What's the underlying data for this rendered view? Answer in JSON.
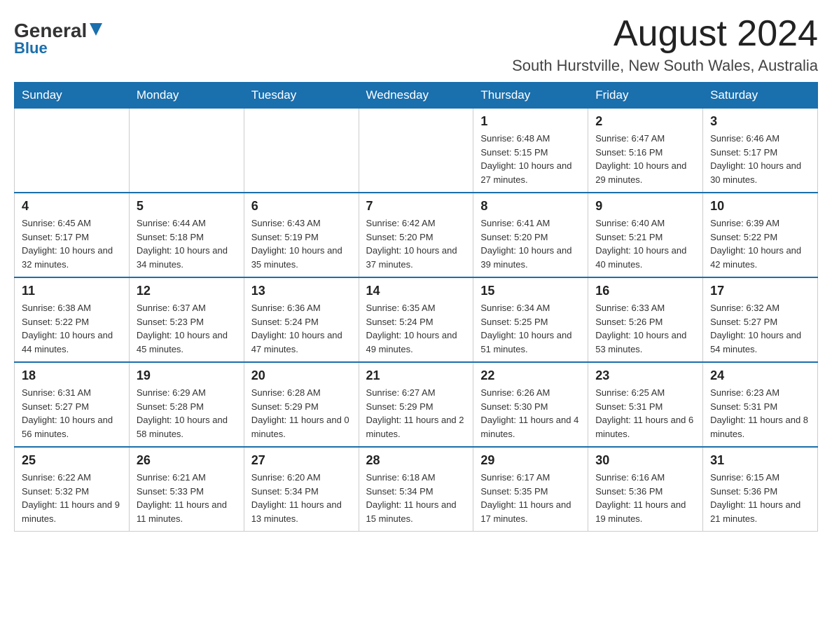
{
  "header": {
    "logo_general": "General",
    "logo_blue": "Blue",
    "month_title": "August 2024",
    "location": "South Hurstville, New South Wales, Australia"
  },
  "days_of_week": [
    "Sunday",
    "Monday",
    "Tuesday",
    "Wednesday",
    "Thursday",
    "Friday",
    "Saturday"
  ],
  "weeks": [
    [
      {
        "day": "",
        "info": ""
      },
      {
        "day": "",
        "info": ""
      },
      {
        "day": "",
        "info": ""
      },
      {
        "day": "",
        "info": ""
      },
      {
        "day": "1",
        "info": "Sunrise: 6:48 AM\nSunset: 5:15 PM\nDaylight: 10 hours and 27 minutes."
      },
      {
        "day": "2",
        "info": "Sunrise: 6:47 AM\nSunset: 5:16 PM\nDaylight: 10 hours and 29 minutes."
      },
      {
        "day": "3",
        "info": "Sunrise: 6:46 AM\nSunset: 5:17 PM\nDaylight: 10 hours and 30 minutes."
      }
    ],
    [
      {
        "day": "4",
        "info": "Sunrise: 6:45 AM\nSunset: 5:17 PM\nDaylight: 10 hours and 32 minutes."
      },
      {
        "day": "5",
        "info": "Sunrise: 6:44 AM\nSunset: 5:18 PM\nDaylight: 10 hours and 34 minutes."
      },
      {
        "day": "6",
        "info": "Sunrise: 6:43 AM\nSunset: 5:19 PM\nDaylight: 10 hours and 35 minutes."
      },
      {
        "day": "7",
        "info": "Sunrise: 6:42 AM\nSunset: 5:20 PM\nDaylight: 10 hours and 37 minutes."
      },
      {
        "day": "8",
        "info": "Sunrise: 6:41 AM\nSunset: 5:20 PM\nDaylight: 10 hours and 39 minutes."
      },
      {
        "day": "9",
        "info": "Sunrise: 6:40 AM\nSunset: 5:21 PM\nDaylight: 10 hours and 40 minutes."
      },
      {
        "day": "10",
        "info": "Sunrise: 6:39 AM\nSunset: 5:22 PM\nDaylight: 10 hours and 42 minutes."
      }
    ],
    [
      {
        "day": "11",
        "info": "Sunrise: 6:38 AM\nSunset: 5:22 PM\nDaylight: 10 hours and 44 minutes."
      },
      {
        "day": "12",
        "info": "Sunrise: 6:37 AM\nSunset: 5:23 PM\nDaylight: 10 hours and 45 minutes."
      },
      {
        "day": "13",
        "info": "Sunrise: 6:36 AM\nSunset: 5:24 PM\nDaylight: 10 hours and 47 minutes."
      },
      {
        "day": "14",
        "info": "Sunrise: 6:35 AM\nSunset: 5:24 PM\nDaylight: 10 hours and 49 minutes."
      },
      {
        "day": "15",
        "info": "Sunrise: 6:34 AM\nSunset: 5:25 PM\nDaylight: 10 hours and 51 minutes."
      },
      {
        "day": "16",
        "info": "Sunrise: 6:33 AM\nSunset: 5:26 PM\nDaylight: 10 hours and 53 minutes."
      },
      {
        "day": "17",
        "info": "Sunrise: 6:32 AM\nSunset: 5:27 PM\nDaylight: 10 hours and 54 minutes."
      }
    ],
    [
      {
        "day": "18",
        "info": "Sunrise: 6:31 AM\nSunset: 5:27 PM\nDaylight: 10 hours and 56 minutes."
      },
      {
        "day": "19",
        "info": "Sunrise: 6:29 AM\nSunset: 5:28 PM\nDaylight: 10 hours and 58 minutes."
      },
      {
        "day": "20",
        "info": "Sunrise: 6:28 AM\nSunset: 5:29 PM\nDaylight: 11 hours and 0 minutes."
      },
      {
        "day": "21",
        "info": "Sunrise: 6:27 AM\nSunset: 5:29 PM\nDaylight: 11 hours and 2 minutes."
      },
      {
        "day": "22",
        "info": "Sunrise: 6:26 AM\nSunset: 5:30 PM\nDaylight: 11 hours and 4 minutes."
      },
      {
        "day": "23",
        "info": "Sunrise: 6:25 AM\nSunset: 5:31 PM\nDaylight: 11 hours and 6 minutes."
      },
      {
        "day": "24",
        "info": "Sunrise: 6:23 AM\nSunset: 5:31 PM\nDaylight: 11 hours and 8 minutes."
      }
    ],
    [
      {
        "day": "25",
        "info": "Sunrise: 6:22 AM\nSunset: 5:32 PM\nDaylight: 11 hours and 9 minutes."
      },
      {
        "day": "26",
        "info": "Sunrise: 6:21 AM\nSunset: 5:33 PM\nDaylight: 11 hours and 11 minutes."
      },
      {
        "day": "27",
        "info": "Sunrise: 6:20 AM\nSunset: 5:34 PM\nDaylight: 11 hours and 13 minutes."
      },
      {
        "day": "28",
        "info": "Sunrise: 6:18 AM\nSunset: 5:34 PM\nDaylight: 11 hours and 15 minutes."
      },
      {
        "day": "29",
        "info": "Sunrise: 6:17 AM\nSunset: 5:35 PM\nDaylight: 11 hours and 17 minutes."
      },
      {
        "day": "30",
        "info": "Sunrise: 6:16 AM\nSunset: 5:36 PM\nDaylight: 11 hours and 19 minutes."
      },
      {
        "day": "31",
        "info": "Sunrise: 6:15 AM\nSunset: 5:36 PM\nDaylight: 11 hours and 21 minutes."
      }
    ]
  ]
}
